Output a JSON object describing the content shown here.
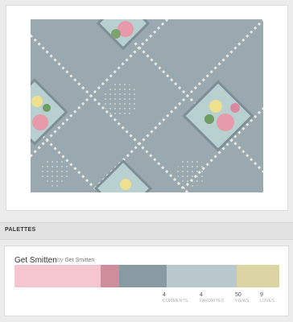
{
  "section": {
    "title": "PALETTES"
  },
  "palette": {
    "name": "Get Smitten",
    "by_prefix": "by",
    "by_author": "Get Smitten",
    "colors": [
      "#f6c6d0",
      "#cf8d9c",
      "#8a9aa2",
      "#b8c8cc",
      "#dcd5a3"
    ],
    "color_widths": [
      0.325,
      0.07,
      0.18,
      0.265,
      0.16
    ],
    "stats": [
      {
        "value": "4",
        "label": "COMMENTS"
      },
      {
        "value": "4",
        "label": "FAVORITES"
      },
      {
        "value": "50",
        "label": "VIEWS"
      },
      {
        "value": "9",
        "label": "LOVES"
      }
    ]
  }
}
